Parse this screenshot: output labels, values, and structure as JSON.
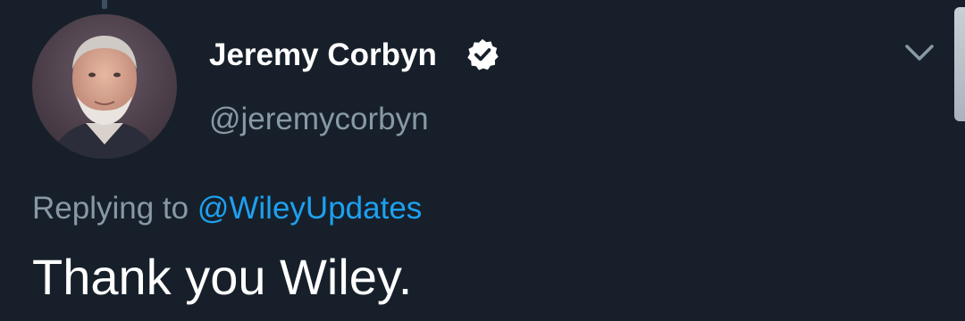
{
  "tweet": {
    "author": {
      "display_name": "Jeremy Corbyn",
      "handle": "@jeremycorbyn",
      "verified": true
    },
    "reply": {
      "prefix": "Replying to",
      "mention": "@WileyUpdates"
    },
    "text": "Thank you Wiley."
  },
  "icons": {
    "verified": "verified-badge-icon",
    "menu": "chevron-down-icon"
  },
  "colors": {
    "background": "#17202a",
    "primary_text": "#ffffff",
    "secondary_text": "#8899a6",
    "link": "#1da1f2"
  }
}
